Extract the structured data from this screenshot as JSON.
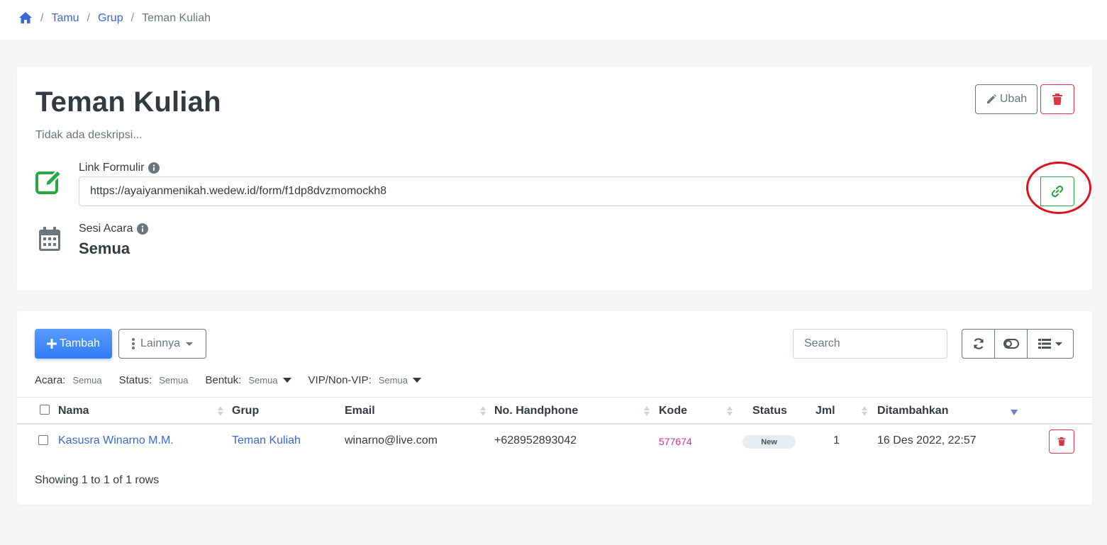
{
  "breadcrumb": {
    "home_icon": "home-icon",
    "items": [
      "Tamu",
      "Grup"
    ],
    "current": "Teman Kuliah",
    "separator": "/"
  },
  "group": {
    "title": "Teman Kuliah",
    "description": "Tidak ada deskripsi...",
    "edit_label": "Ubah"
  },
  "link_form": {
    "label": "Link Formulir",
    "value": "https://ayaiyanmenikah.wedew.id/form/f1dp8dvzmomockh8"
  },
  "session": {
    "label": "Sesi Acara",
    "value": "Semua"
  },
  "toolbar": {
    "add_label": "Tambah",
    "more_label": "Lainnya",
    "search_placeholder": "Search"
  },
  "filters": [
    {
      "label": "Acara:",
      "value": "Semua",
      "dropdown": false
    },
    {
      "label": "Status:",
      "value": "Semua",
      "dropdown": false
    },
    {
      "label": "Bentuk:",
      "value": "Semua",
      "dropdown": true
    },
    {
      "label": "VIP/Non-VIP:",
      "value": "Semua",
      "dropdown": true
    }
  ],
  "table": {
    "columns": [
      "Nama",
      "Grup",
      "Email",
      "No. Handphone",
      "Kode",
      "Status",
      "Jml",
      "Ditambahkan"
    ],
    "rows": [
      {
        "nama": "Kasusra Winarno M.M.",
        "grup": "Teman Kuliah",
        "email": "winarno@live.com",
        "phone": "+628952893042",
        "kode": "577674",
        "status": "New",
        "jml": "1",
        "ditambahkan": "16 Des 2022, 22:57"
      }
    ]
  },
  "footer": {
    "showing": "Showing 1 to 1 of 1 rows"
  },
  "colors": {
    "primary": "#3b66d8",
    "success": "#28a745",
    "danger": "#dc3545",
    "annotation": "#e0101b",
    "kode": "#d63384"
  }
}
